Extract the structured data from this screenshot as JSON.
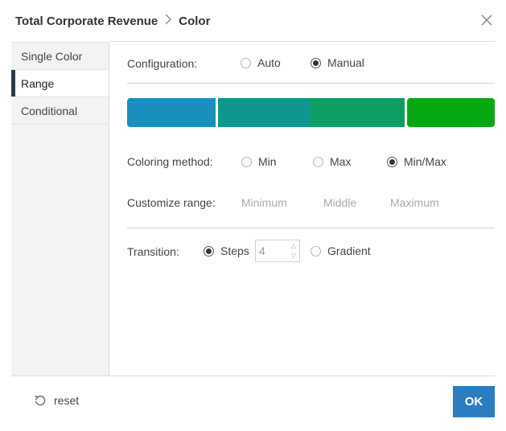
{
  "header": {
    "breadcrumb_root": "Total Corporate Revenue",
    "breadcrumb_current": "Color",
    "separator_icon": "chevron-right",
    "close_icon": "close-x"
  },
  "sidebar": {
    "items": [
      {
        "label": "Single Color",
        "active": false
      },
      {
        "label": "Range",
        "active": true
      },
      {
        "label": "Conditional",
        "active": false
      }
    ]
  },
  "configuration": {
    "label": "Configuration:",
    "options": [
      {
        "label": "Auto",
        "selected": false
      },
      {
        "label": "Manual",
        "selected": true
      }
    ]
  },
  "color_range": {
    "segments": [
      "#1a8ebf",
      "#11968f",
      "#0f9e63",
      "#07a812"
    ]
  },
  "coloring_method": {
    "label": "Coloring method:",
    "options": [
      {
        "label": "Min",
        "selected": false
      },
      {
        "label": "Max",
        "selected": false
      },
      {
        "label": "Min/Max",
        "selected": true
      }
    ]
  },
  "customize_range": {
    "label": "Customize range:",
    "minimum_placeholder": "Minimum",
    "middle_placeholder": "Middle",
    "maximum_placeholder": "Maximum"
  },
  "transition": {
    "label": "Transition:",
    "steps_label": "Steps",
    "steps_selected": true,
    "steps_value": "4",
    "gradient_label": "Gradient",
    "gradient_selected": false
  },
  "footer": {
    "reset_label": "reset",
    "reset_icon": "undo-arrow",
    "ok_label": "OK"
  },
  "colors": {
    "accent": "#2c7cc0",
    "sidebar_active_marker": "#2b3a4a"
  }
}
